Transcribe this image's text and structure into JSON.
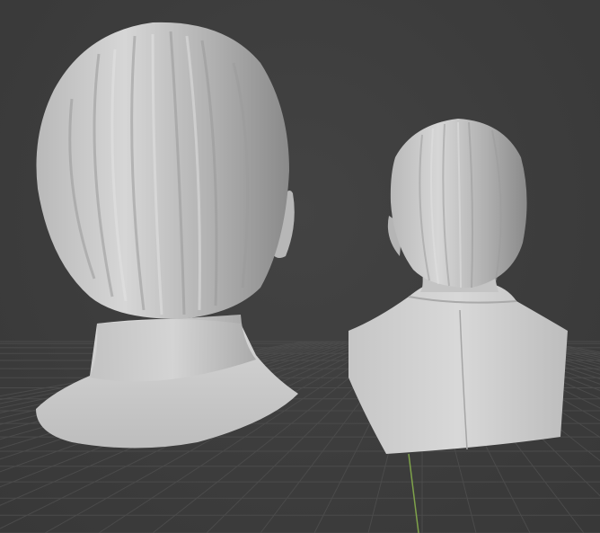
{
  "viewport": {
    "background_color": "#3d3d3d",
    "grid_color": "#4b4b4b",
    "y_axis_color": "#7fa34a"
  },
  "objects": [
    {
      "name": "head-bust-back-view"
    },
    {
      "name": "bust-with-jacket-back-view"
    }
  ],
  "material": {
    "clay_color": "#c9c9c9",
    "shadow_color": "#8d8d8d"
  }
}
